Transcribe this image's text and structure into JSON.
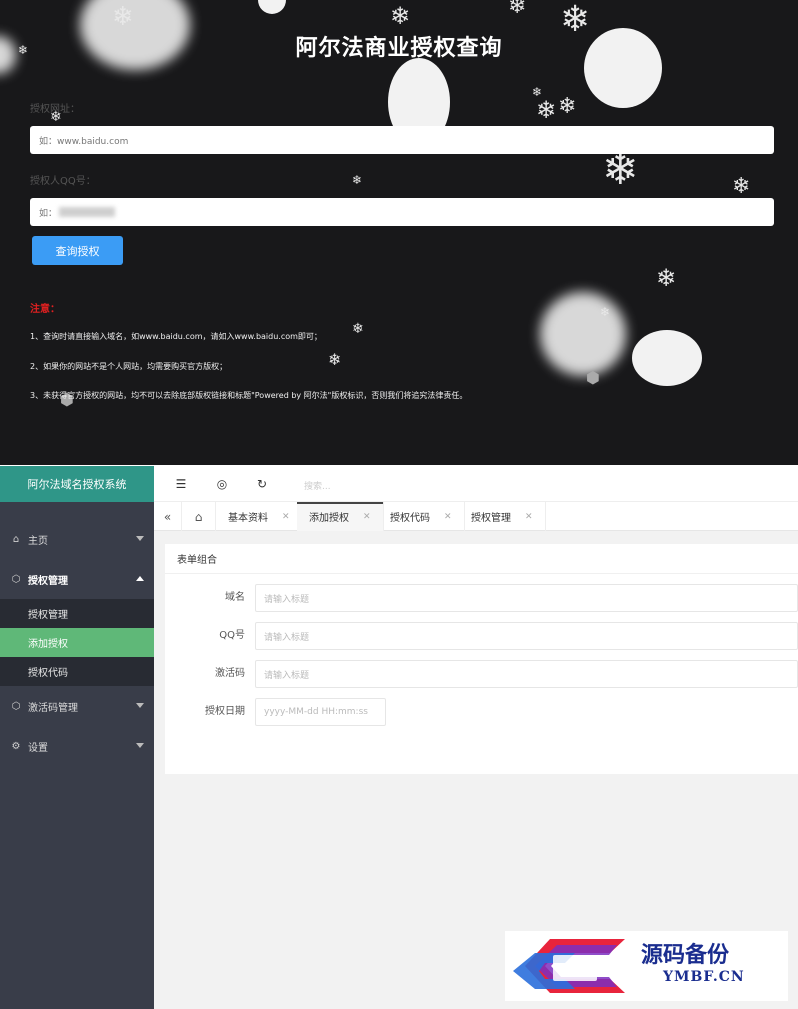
{
  "query": {
    "title": "阿尔法商业授权查询",
    "domain_label": "授权网址：",
    "domain_placeholder": "如：www.baidu.com",
    "qq_label": "授权人QQ号：",
    "qq_placeholder": "如：",
    "submit_label": "查询授权",
    "note_title": "注意：",
    "notes": [
      "1、查询时请直接输入域名，如www.baidu.com，请如入www.baidu.com即可；",
      "2、如果你的网站不是个人网站，均需要购买官方版权；",
      "3、未获得官方授权的网站，均不可以去除底部版权链接和标题\"Powered by 阿尔法\"版权标识，否则我们将追究法律责任。"
    ]
  },
  "admin": {
    "logo": "阿尔法域名授权系统",
    "sidebar": {
      "items": [
        {
          "label": "主页",
          "icon": "home-icon"
        },
        {
          "label": "授权管理",
          "icon": "cube-icon"
        },
        {
          "label": "激活码管理",
          "icon": "cube-icon"
        },
        {
          "label": "设置",
          "icon": "gear-icon"
        }
      ],
      "sub_items": [
        "授权管理",
        "添加授权",
        "授权代码"
      ]
    },
    "topbar": {
      "search_placeholder": "搜索..."
    },
    "tabs": [
      "基本资料",
      "添加授权",
      "授权代码",
      "授权管理"
    ],
    "form": {
      "title": "表单组合",
      "fields": [
        {
          "label": "域名",
          "placeholder": "请输入标题"
        },
        {
          "label": "QQ号",
          "placeholder": "请输入标题"
        },
        {
          "label": "激活码",
          "placeholder": "请输入标题"
        },
        {
          "label": "授权日期",
          "placeholder": "yyyy-MM-dd HH:mm:ss"
        }
      ]
    }
  },
  "watermark": {
    "text": "源码备份",
    "sub": "YMBF.CN"
  },
  "colors": {
    "accent_blue": "#3b9cf5",
    "logo_teal": "#2f9688",
    "active_green": "#5fb878",
    "sidebar_bg": "#393d49",
    "note_red": "#e02020"
  }
}
